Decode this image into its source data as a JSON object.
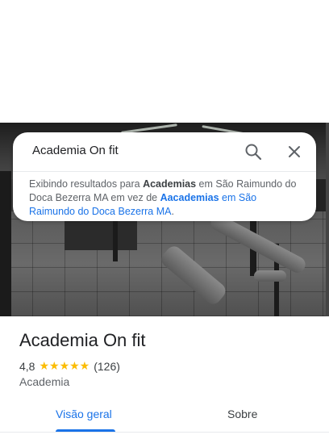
{
  "search": {
    "query": "Academia On fit"
  },
  "notice": {
    "prefix": "Exibindo resultados para ",
    "corrected": "Academias",
    "middle": " em São Raimundo do Doca Bezerra MA em vez de ",
    "original": "Aacademias",
    "suffix": " em São Raimundo do Doca Bezerra MA",
    "end": "."
  },
  "place": {
    "name": "Academia On fit",
    "rating": "4,8",
    "stars": "★★★★★",
    "review_count": "(126)",
    "category": "Academia"
  },
  "tabs": [
    {
      "label": "Visão geral",
      "active": true
    },
    {
      "label": "Sobre",
      "active": false
    }
  ],
  "colors": {
    "accent": "#1a73e8",
    "star": "#fbbc04"
  }
}
